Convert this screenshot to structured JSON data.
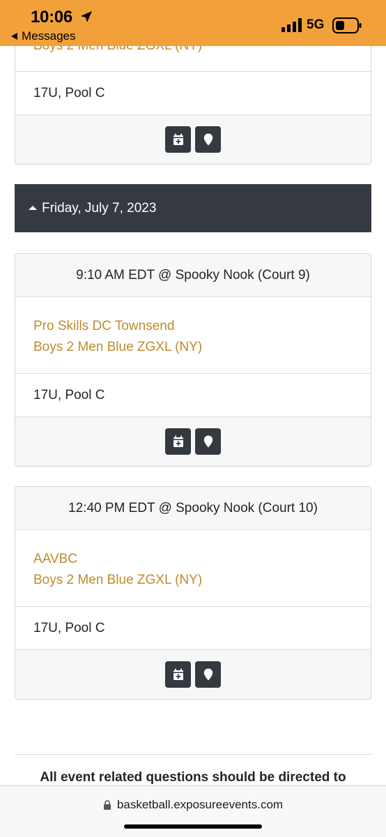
{
  "status_bar": {
    "time": "10:06",
    "back_app": "Messages",
    "network": "5G"
  },
  "prev_card": {
    "partial_team": "Boys 2 Men Blue ZGXL (NY)",
    "division": "17U, Pool C"
  },
  "date_header": "Friday, July 7, 2023",
  "games": [
    {
      "time_location": "9:10 AM EDT @ Spooky Nook (Court 9)",
      "team1": "Pro Skills DC Townsend",
      "team2": "Boys 2 Men Blue ZGXL (NY)",
      "division": "17U, Pool C"
    },
    {
      "time_location": "12:40 PM EDT @ Spooky Nook (Court 10)",
      "team1": "AAVBC",
      "team2": "Boys 2 Men Blue ZGXL (NY)",
      "division": "17U, Pool C"
    }
  ],
  "footer_note": "All event related questions should be directed to",
  "url": "basketball.exposureevents.com",
  "icons": {
    "calendar": "calendar-plus-icon",
    "location": "map-marker-icon"
  },
  "colors": {
    "status_bar": "#f2a13a",
    "team_link": "#c08a2d",
    "dark": "#343a40"
  }
}
